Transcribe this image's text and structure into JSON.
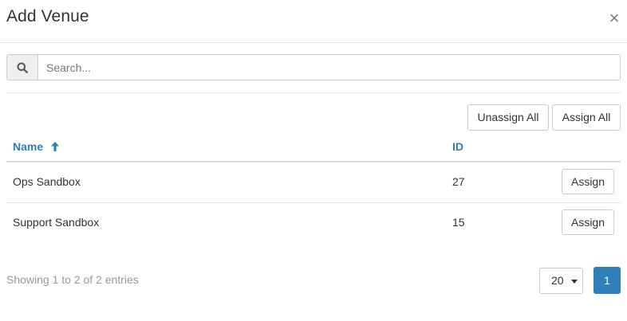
{
  "modal": {
    "title": "Add Venue",
    "close_glyph": "×"
  },
  "search": {
    "placeholder": "Search...",
    "value": "",
    "icon": "search-icon"
  },
  "actions": {
    "unassign_all_label": "Unassign All",
    "assign_all_label": "Assign All"
  },
  "table": {
    "columns": {
      "name": "Name",
      "id": "ID"
    },
    "sort": {
      "column": "Name",
      "direction": "ascending",
      "icon": "arrow-up-icon"
    },
    "rows": [
      {
        "name": "Ops Sandbox",
        "id": "27",
        "action_label": "Assign"
      },
      {
        "name": "Support Sandbox",
        "id": "15",
        "action_label": "Assign"
      }
    ]
  },
  "footer": {
    "info": "Showing 1 to 2 of 2 entries",
    "page_size": "20",
    "current_page": "1"
  },
  "colors": {
    "accent": "#2f7fb8",
    "muted_text": "#999999",
    "border": "#cccccc"
  }
}
